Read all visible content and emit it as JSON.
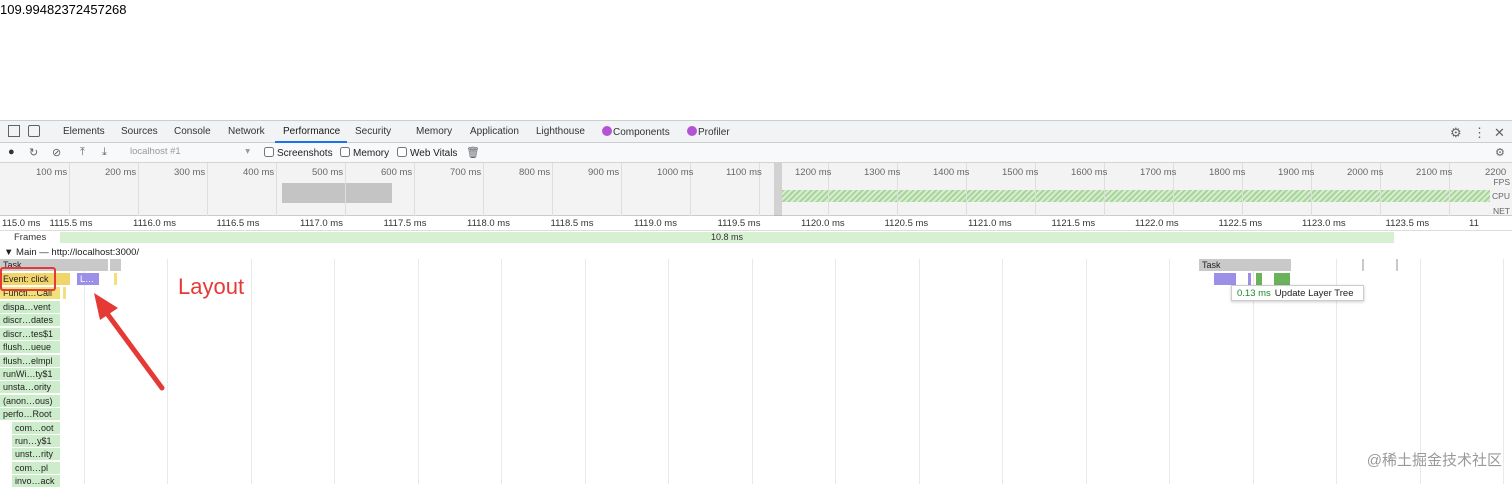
{
  "page_value": "109.99482372457268",
  "devtools": {
    "tabs": [
      {
        "label": "Elements"
      },
      {
        "label": "Sources"
      },
      {
        "label": "Console"
      },
      {
        "label": "Network"
      },
      {
        "label": "Performance",
        "active": true
      },
      {
        "label": "Security"
      },
      {
        "label": "Memory"
      },
      {
        "label": "Application"
      },
      {
        "label": "Lighthouse"
      },
      {
        "label": "Components"
      },
      {
        "label": "Profiler"
      }
    ],
    "toolbar": {
      "profile_select": "localhost #1",
      "checkboxes": [
        "Screenshots",
        "Memory",
        "Web Vitals"
      ]
    },
    "overview": {
      "ticks": [
        "100 ms",
        "200 ms",
        "300 ms",
        "400 ms",
        "500 ms",
        "600 ms",
        "700 ms",
        "800 ms",
        "900 ms",
        "1000 ms",
        "1100 ms",
        "1200 ms",
        "1300 ms",
        "1400 ms",
        "1500 ms",
        "1600 ms",
        "1700 ms",
        "1800 ms",
        "1900 ms",
        "2000 ms",
        "2100 ms",
        "2200"
      ],
      "lanes": [
        "FPS",
        "CPU",
        "NET"
      ]
    },
    "ruler_ticks": [
      "115.0 ms",
      "1115.5 ms",
      "1116.0 ms",
      "1116.5 ms",
      "1117.0 ms",
      "1117.5 ms",
      "1118.0 ms",
      "1118.5 ms",
      "1119.0 ms",
      "1119.5 ms",
      "1120.0 ms",
      "1120.5 ms",
      "1121.0 ms",
      "1121.5 ms",
      "1122.0 ms",
      "1122.5 ms",
      "1123.0 ms",
      "1123.5 ms",
      "11"
    ],
    "frames": {
      "label": "Frames",
      "duration": "10.8 ms"
    },
    "main_thread": "▼ Main — http://localhost:3000/",
    "flame": {
      "task_label": "Task",
      "event_label": "Event: click",
      "func_label": "Functi…Call",
      "layout_short": "L…",
      "stack": [
        "dispa…vent",
        "discr…dates",
        "discr…tes$1",
        "flush…ueue",
        "flush…elmpl",
        "runWi…ty$1",
        "unsta…ority",
        "(anon…ous)",
        "perfo…Root",
        "com…oot",
        "run…y$1",
        "unst…rity",
        "com…pl",
        "invo…ack"
      ],
      "right_task_label": "Task"
    },
    "tooltip": {
      "time": "0.13 ms",
      "label": "Update Layer Tree"
    }
  },
  "annotation": {
    "text": "Layout",
    "color": "#e53935"
  },
  "watermark": "@稀土掘金技术社区",
  "colors": {
    "accent": "#1a73e8",
    "task": "#c9c9c9",
    "scripting": "#f2d56a",
    "rendering": "#9b8fe8",
    "painting": "#6ab35a"
  }
}
